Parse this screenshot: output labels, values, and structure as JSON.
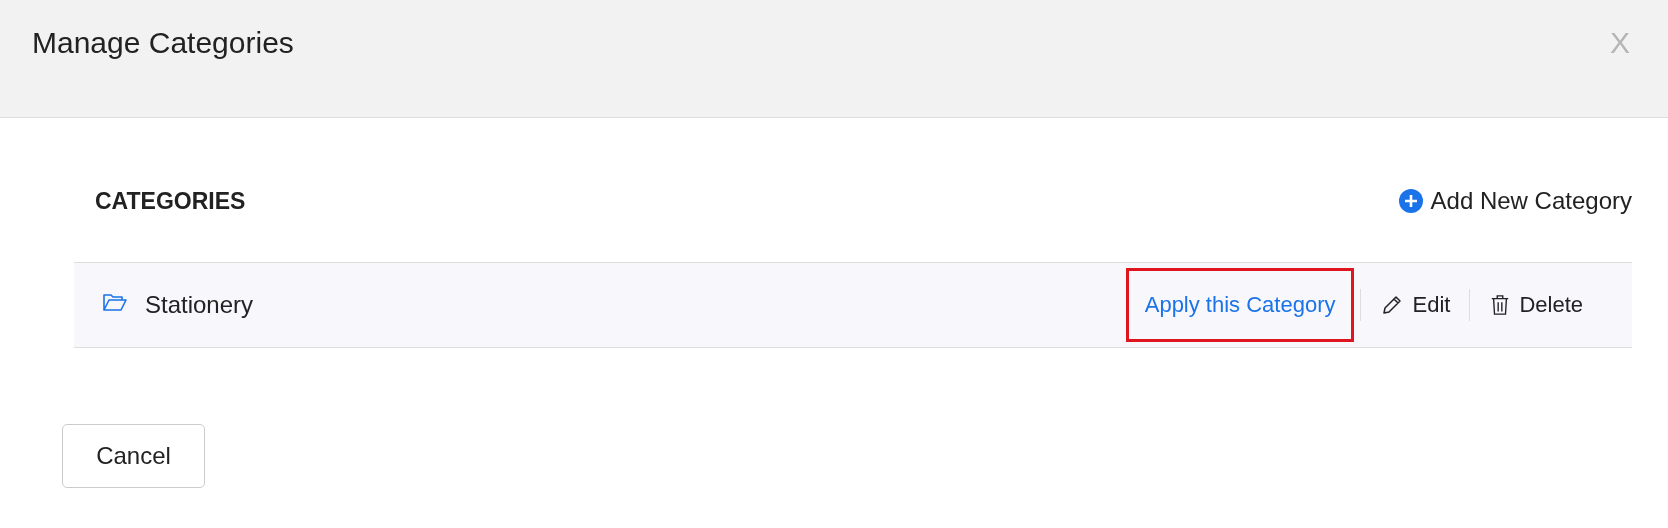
{
  "dialog": {
    "title": "Manage Categories",
    "close": "X"
  },
  "section": {
    "heading": "CATEGORIES",
    "add_button": "Add New Category"
  },
  "categories": [
    {
      "name": "Stationery",
      "actions": [
        {
          "kind": "apply",
          "label": "Apply this Category",
          "highlighted": true
        },
        {
          "kind": "edit",
          "label": "Edit",
          "highlighted": false
        },
        {
          "kind": "delete",
          "label": "Delete",
          "highlighted": false
        }
      ]
    }
  ],
  "buttons": [
    "Cancel"
  ]
}
